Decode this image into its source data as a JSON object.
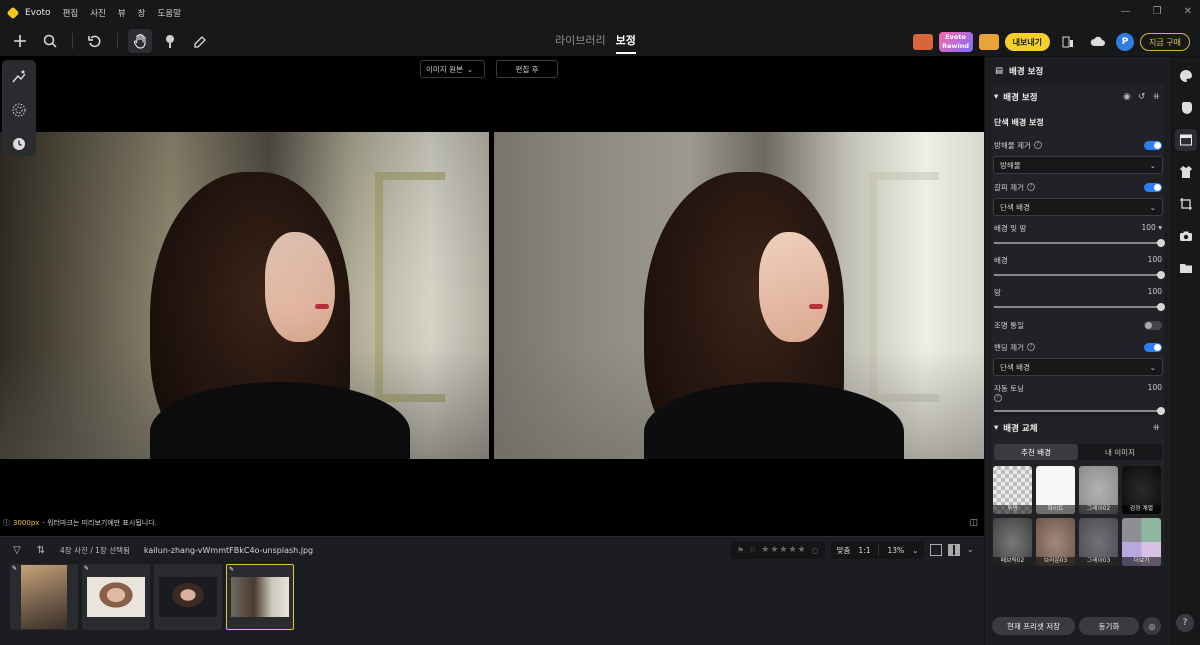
{
  "app": {
    "name": "Evoto",
    "menu": [
      "편집",
      "사진",
      "뷰",
      "창",
      "도움말"
    ]
  },
  "toolbar": {
    "tab_library": "라이브러리",
    "tab_edit": "보정",
    "rewind_line1": "Evoto",
    "rewind_line2": "Rewind",
    "export_label": "내보내기",
    "avatar_letter": "P",
    "buy_label": "지금 구매"
  },
  "canvas": {
    "compare_mode": "이미지 원본",
    "after_label": "편집 후",
    "px_value": "3000px",
    "watermark_note": "- 워터마크는 미리보기에만 표시됩니다."
  },
  "filmstrip": {
    "count_label": "4장 사진 / 1장 선택됨",
    "file_name": "kailun-zhang-vWmmtFBkC4o-unsplash.jpg",
    "stars": "★★★★★",
    "zoom_fit": "맞춤",
    "zoom_1to1": "1:1",
    "zoom_percent": "13%"
  },
  "panel": {
    "header": "배경 보정",
    "section1_title": "배경 보정",
    "subsection_title": "단색 배경 보정",
    "rows": {
      "remove_obstacles": "방해물 제거",
      "obstacles_option": "방해물",
      "remove_wrinkles": "갈피 제거",
      "wrinkles_option": "단색 배경",
      "bg_and_floor": "배경 및 땅",
      "bg_and_floor_value": "100",
      "background": "배경",
      "background_value": "100",
      "floor": "땅",
      "floor_value": "100",
      "light_unify": "조명 통일",
      "remove_banding": "밴딩 제거",
      "banding_option": "단색 배경",
      "auto_tone": "자동 토닝",
      "auto_tone_value": "100"
    },
    "section2_title": "배경 교체",
    "replace_tabs": [
      "추천 배경",
      "내 이미지"
    ],
    "backgrounds": [
      {
        "name": "투명",
        "color": "#cfcfcf"
      },
      {
        "name": "화이트",
        "color": "#f7f7f7"
      },
      {
        "name": "그레이02",
        "color": "#9a9a9a"
      },
      {
        "name": "검정 계열",
        "color": "#1a1a1a"
      },
      {
        "name": "페브릭02",
        "color": "#5b5c5e"
      },
      {
        "name": "브라운03",
        "color": "#8a6f62"
      },
      {
        "name": "그레이03",
        "color": "#5d5d62"
      },
      {
        "name": "더보기",
        "color": "#c9a7d6"
      }
    ],
    "save_preset": "현재 프리셋 저장",
    "sync_label": "동기화"
  },
  "help_label": "?"
}
